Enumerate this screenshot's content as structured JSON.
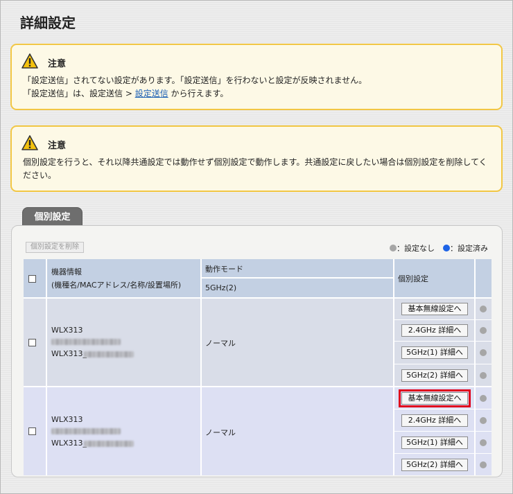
{
  "page": {
    "title": "詳細設定"
  },
  "notices": [
    {
      "title": "注意",
      "line1": "「設定送信」されてない設定があります。「設定送信」を行わないと設定が反映されません。",
      "line2_prefix": "「設定送信」は、設定送信 > ",
      "line2_link": "設定送信",
      "line2_suffix": " から行えます。"
    },
    {
      "title": "注意",
      "body": "個別設定を行うと、それ以降共通設定では動作せず個別設定で動作します。共通設定に戻したい場合は個別設定を削除してください。"
    }
  ],
  "panel": {
    "tab_label": "個別設定",
    "delete_button": "個別設定を削除",
    "legend": {
      "unset": "：設定なし",
      "set": "：設定済み"
    },
    "colors": {
      "unset_dot": "#a6a6a6",
      "set_dot": "#1d63e6",
      "highlight": "#e0001b"
    }
  },
  "table": {
    "headers": {
      "device_info_line1": "機器情報",
      "device_info_line2": "(機種名/MACアドレス/名称/設置場所)",
      "mode": "動作モード",
      "band": "5GHz(2)",
      "individual": "個別設定"
    },
    "rows": [
      {
        "model": "WLX313",
        "name_prefix": "WLX313_",
        "mode": "ノーマル",
        "buttons": [
          "基本無線設定へ",
          "2.4GHz 詳細へ",
          "5GHz(1) 詳細へ",
          "5GHz(2) 詳細へ"
        ],
        "status": [
          "unset",
          "unset",
          "unset",
          "unset"
        ]
      },
      {
        "model": "WLX313",
        "name_prefix": "WLX313_",
        "mode": "ノーマル",
        "buttons": [
          "基本無線設定へ",
          "2.4GHz 詳細へ",
          "5GHz(1) 詳細へ",
          "5GHz(2) 詳細へ"
        ],
        "status": [
          "unset",
          "unset",
          "unset",
          "unset"
        ],
        "highlighted_button": 0
      }
    ]
  }
}
